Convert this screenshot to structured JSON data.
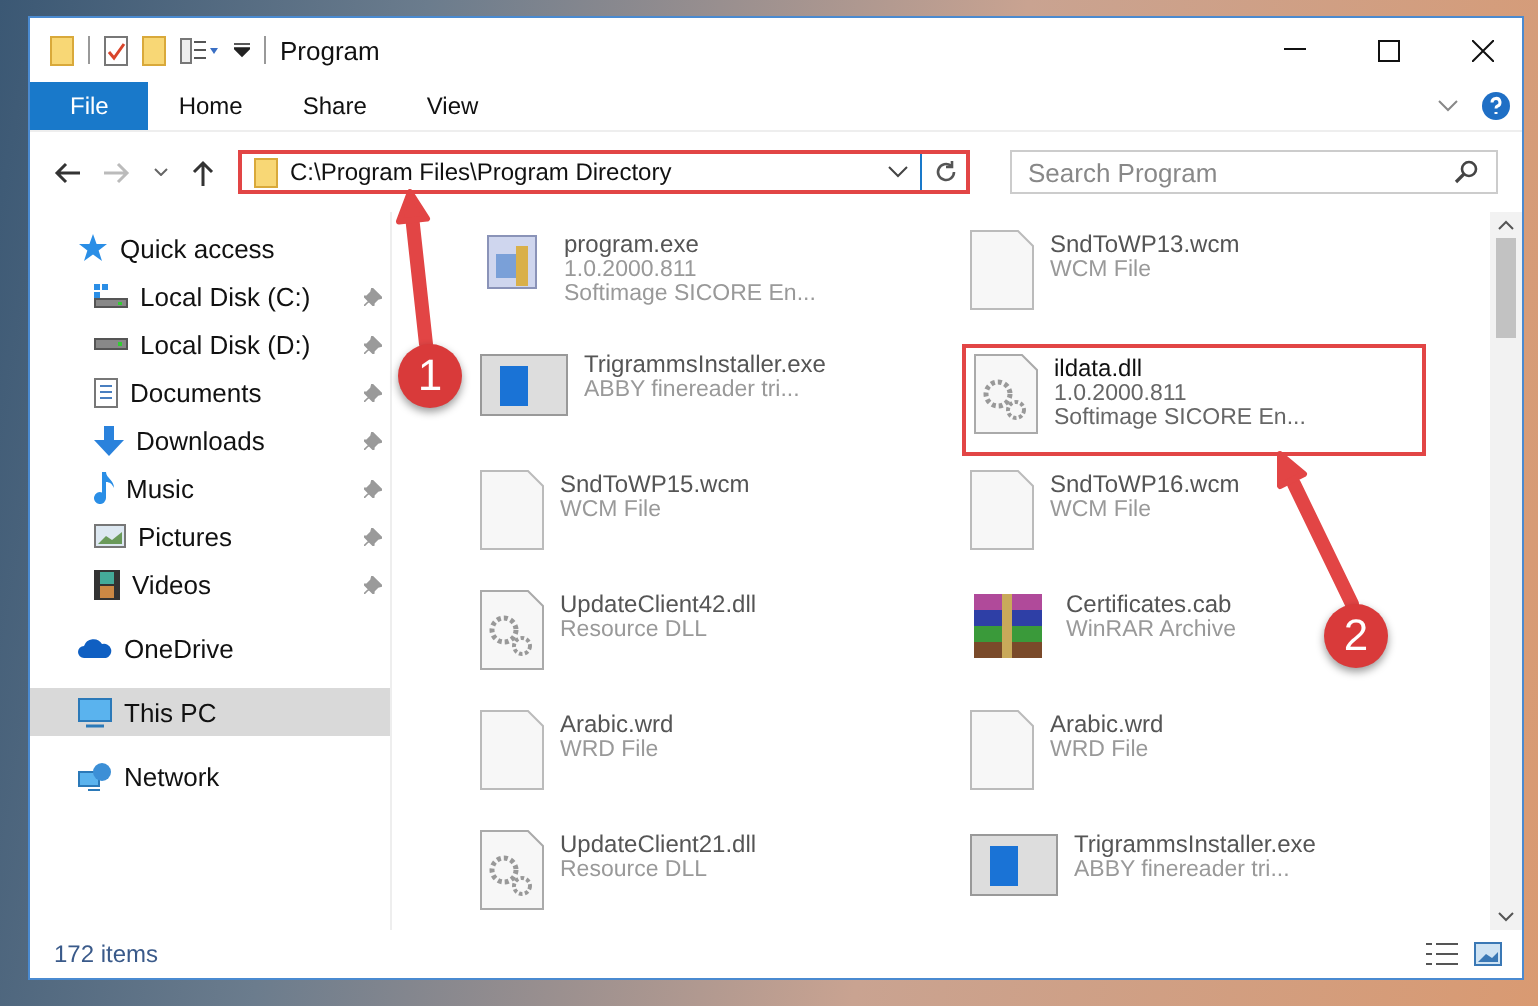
{
  "window": {
    "title": "Program"
  },
  "ribbon_tabs": [
    {
      "label": "File",
      "kind": "menu",
      "selected": false
    },
    {
      "label": "Home",
      "kind": "tab",
      "selected": false
    },
    {
      "label": "Share",
      "kind": "tab",
      "selected": false
    },
    {
      "label": "View",
      "kind": "tab",
      "selected": false
    }
  ],
  "address_bar": {
    "value": "C:\\Program Files\\Program Directory",
    "highlighted": true
  },
  "search": {
    "placeholder": "Search Program"
  },
  "sidebar": {
    "items": [
      {
        "label": "Quick access",
        "kind": "star",
        "selected": false,
        "children": [
          {
            "label": "Local Disk (C:)",
            "kind": "disk-c",
            "pinned": true,
            "selected": false
          },
          {
            "label": "Local Disk (D:)",
            "kind": "disk",
            "pinned": true,
            "selected": false
          },
          {
            "label": "Documents",
            "kind": "document",
            "pinned": true,
            "selected": false
          },
          {
            "label": "Downloads",
            "kind": "download",
            "pinned": true,
            "selected": false
          },
          {
            "label": "Music",
            "kind": "music",
            "pinned": true,
            "selected": false
          },
          {
            "label": "Pictures",
            "kind": "picture",
            "pinned": true,
            "selected": false
          },
          {
            "label": "Videos",
            "kind": "video",
            "pinned": true,
            "selected": false
          }
        ]
      },
      {
        "label": "OneDrive",
        "kind": "cloud",
        "selected": false
      },
      {
        "label": "This PC",
        "kind": "pc",
        "selected": true
      },
      {
        "label": "Network",
        "kind": "network",
        "selected": false
      }
    ]
  },
  "files": [
    {
      "name": "program.exe",
      "kind": "setup",
      "lines": [
        "1.0.2000.811",
        "Softimage SICORE En..."
      ],
      "highlighted": false
    },
    {
      "name": "SndToWP13.wcm",
      "kind": "blank",
      "lines": [
        "WCM File"
      ],
      "highlighted": false
    },
    {
      "name": "TrigrammsInstaller.exe",
      "kind": "window",
      "lines": [
        "ABBY finereader tri..."
      ],
      "highlighted": false
    },
    {
      "name": "ildata.dll",
      "kind": "gear",
      "lines": [
        "1.0.2000.811",
        "Softimage SICORE En..."
      ],
      "highlighted": true
    },
    {
      "name": "SndToWP15.wcm",
      "kind": "blank",
      "lines": [
        "WCM File"
      ],
      "highlighted": false
    },
    {
      "name": "SndToWP16.wcm",
      "kind": "blank",
      "lines": [
        "WCM File"
      ],
      "highlighted": false
    },
    {
      "name": "UpdateClient42.dll",
      "kind": "gear",
      "lines": [
        "Resource DLL"
      ],
      "highlighted": false
    },
    {
      "name": "Certificates.cab",
      "kind": "archive",
      "lines": [
        "WinRAR Archive"
      ],
      "highlighted": false
    },
    {
      "name": "Arabic.wrd",
      "kind": "blank",
      "lines": [
        "WRD File"
      ],
      "highlighted": false
    },
    {
      "name": "Arabic.wrd",
      "kind": "blank",
      "lines": [
        "WRD File"
      ],
      "highlighted": false
    },
    {
      "name": "UpdateClient21.dll",
      "kind": "gear",
      "lines": [
        "Resource DLL"
      ],
      "highlighted": false
    },
    {
      "name": "TrigrammsInstaller.exe",
      "kind": "window",
      "lines": [
        "ABBY finereader tri..."
      ],
      "highlighted": false
    }
  ],
  "status_bar": {
    "item_count": "172 items"
  },
  "annotations": [
    {
      "label": "1"
    },
    {
      "label": "2"
    }
  ]
}
